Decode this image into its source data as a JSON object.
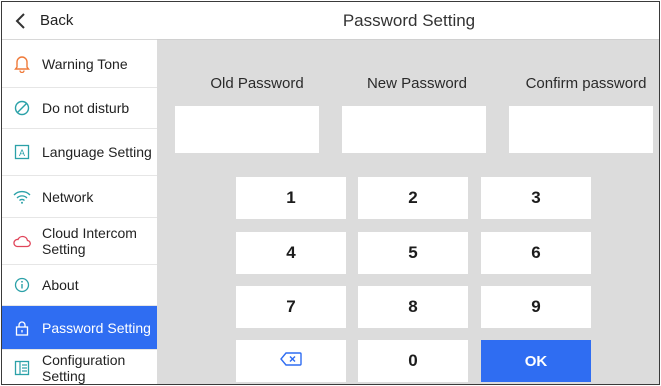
{
  "sidebar": {
    "back_label": "Back",
    "items": [
      {
        "label": "Warning Tone",
        "icon": "bell-icon"
      },
      {
        "label": "Do not disturb",
        "icon": "do-not-disturb-icon"
      },
      {
        "label": "Language Setting",
        "icon": "language-icon"
      },
      {
        "label": "Network",
        "icon": "wifi-icon"
      },
      {
        "label": "Cloud Intercom Setting",
        "icon": "cloud-icon"
      },
      {
        "label": "About",
        "icon": "info-icon"
      },
      {
        "label": "Password Setting",
        "icon": "lock-icon",
        "active": true
      },
      {
        "label": "Configuration Setting",
        "icon": "configuration-icon"
      }
    ]
  },
  "header": {
    "title": "Password Setting"
  },
  "form": {
    "old_password_label": "Old Password",
    "new_password_label": "New Password",
    "confirm_password_label": "Confirm password"
  },
  "keypad": {
    "keys": [
      "1",
      "2",
      "3",
      "4",
      "5",
      "6",
      "7",
      "8",
      "9"
    ],
    "zero": "0",
    "ok": "OK",
    "backspace_icon": "backspace-icon"
  },
  "colors": {
    "accent": "#2f6df2",
    "icon_orange": "#ef7a3a",
    "icon_teal": "#2ba1a8",
    "panel_gray": "#dcdcdc"
  }
}
